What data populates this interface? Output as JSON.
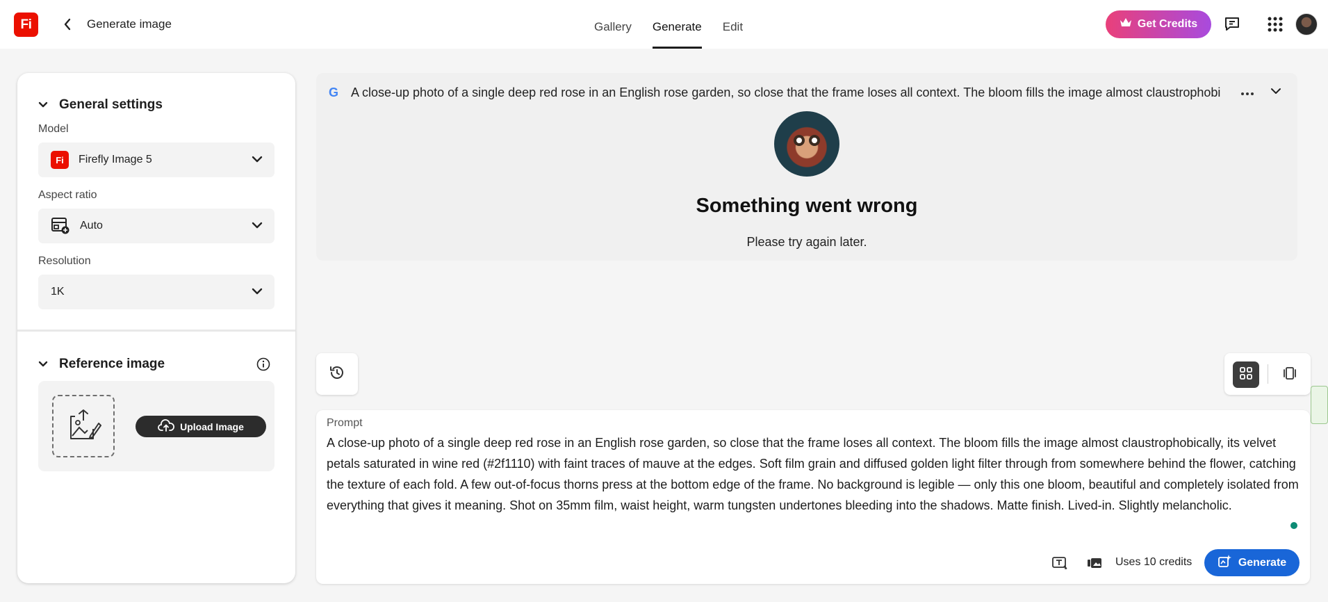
{
  "header": {
    "logo_text": "Fi",
    "page_title": "Generate image",
    "tabs": [
      {
        "label": "Gallery"
      },
      {
        "label": "Generate"
      },
      {
        "label": "Edit"
      }
    ],
    "active_tab": "Generate",
    "get_credits_label": "Get Credits"
  },
  "settings": {
    "general_title": "General settings",
    "model_label": "Model",
    "model_badge": "Fi",
    "model_value": "Firefly Image 5",
    "aspect_label": "Aspect ratio",
    "aspect_value": "Auto",
    "resolution_label": "Resolution",
    "resolution_value": "1K",
    "reference_title": "Reference image",
    "upload_label": "Upload Image"
  },
  "result": {
    "source_badge": "G",
    "prompt_preview": "A close-up photo of a single deep red rose in an English rose garden, so close that the frame loses all context. The bloom fills the image almost claustrophobi",
    "error_title": "Something went wrong",
    "error_message": "Please try again later."
  },
  "prompt": {
    "label": "Prompt",
    "text": "A close-up photo of a single deep red rose in an English rose garden, so close that the frame loses all context. The bloom fills the image almost claustrophobically, its velvet petals saturated in wine red (#2f1110) with faint traces of mauve at the edges. Soft film grain and diffused golden light filter through from somewhere behind the flower, catching the texture of each fold. A few out-of-focus thorns press at the bottom edge of the frame. No background is legible — only this one bloom, beautiful and completely isolated from everything that gives it meaning. Shot on 35mm film, waist height, warm tungsten undertones bleeding into the shadows. Matte finish. Lived-in. Slightly melancholic.",
    "credits_note": "Uses 10 credits",
    "generate_label": "Generate"
  },
  "colors": {
    "brand_red": "#eb1000",
    "generate_blue": "#1966d8",
    "credits_gradient_start": "#e9407a",
    "credits_gradient_end": "#a84bde"
  }
}
